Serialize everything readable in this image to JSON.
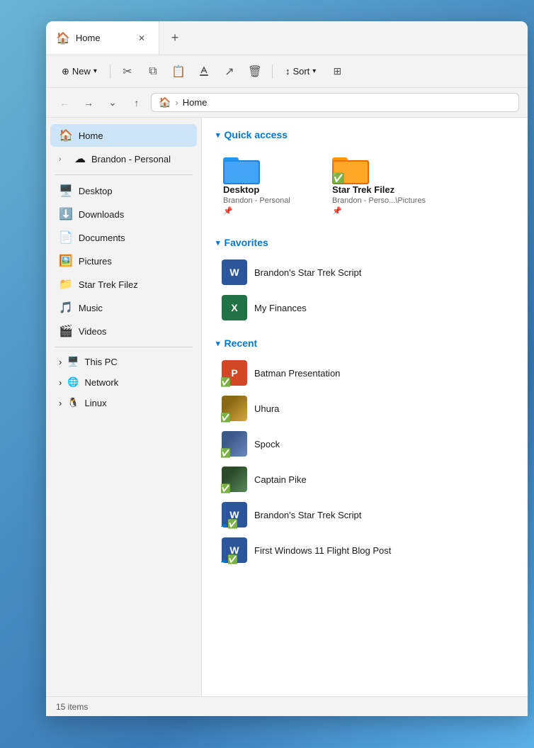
{
  "window": {
    "tab_title": "Home",
    "new_tab_label": "+"
  },
  "toolbar": {
    "new_label": "New",
    "sort_label": "Sort",
    "new_dropdown": "▾"
  },
  "address_bar": {
    "path_home": "Home",
    "path_separator": "›"
  },
  "sidebar": {
    "home_label": "Home",
    "brandon_label": "Brandon - Personal",
    "items": [
      {
        "label": "Desktop",
        "icon": "🖥️"
      },
      {
        "label": "Downloads",
        "icon": "⬇️"
      },
      {
        "label": "Documents",
        "icon": "📄"
      },
      {
        "label": "Pictures",
        "icon": "🖼️"
      },
      {
        "label": "Star Trek Filez",
        "icon": "📁"
      },
      {
        "label": "Music",
        "icon": "🎵"
      },
      {
        "label": "Videos",
        "icon": "🎬"
      }
    ],
    "sections": [
      {
        "label": "This PC",
        "icon": "🖥️"
      },
      {
        "label": "Network",
        "icon": "🌐"
      },
      {
        "label": "Linux",
        "icon": "🐧"
      }
    ]
  },
  "quick_access": {
    "header": "Quick access",
    "items": [
      {
        "name": "Desktop",
        "path": "Brandon - Personal",
        "has_pin": true
      },
      {
        "name": "Star Trek Filez",
        "path": "Brandon - Perso...\\Pictures",
        "has_sync": true,
        "has_pin": true
      }
    ]
  },
  "favorites": {
    "header": "Favorites",
    "items": [
      {
        "name": "Brandon's Star Trek Script",
        "type": "word"
      },
      {
        "name": "My Finances",
        "type": "excel"
      }
    ]
  },
  "recent": {
    "header": "Recent",
    "items": [
      {
        "name": "Batman Presentation",
        "type": "ppt",
        "synced": true
      },
      {
        "name": "Uhura",
        "type": "image-uhura",
        "synced": true
      },
      {
        "name": "Spock",
        "type": "image-spock",
        "synced": true
      },
      {
        "name": "Captain Pike",
        "type": "image-pike",
        "synced": true
      },
      {
        "name": "Brandon's Star Trek Script",
        "type": "word",
        "synced": true,
        "cloud": true
      },
      {
        "name": "First Windows 11 Flight Blog Post",
        "type": "word",
        "synced": true,
        "cloud": true
      }
    ]
  },
  "status_bar": {
    "items_count": "15 items"
  }
}
